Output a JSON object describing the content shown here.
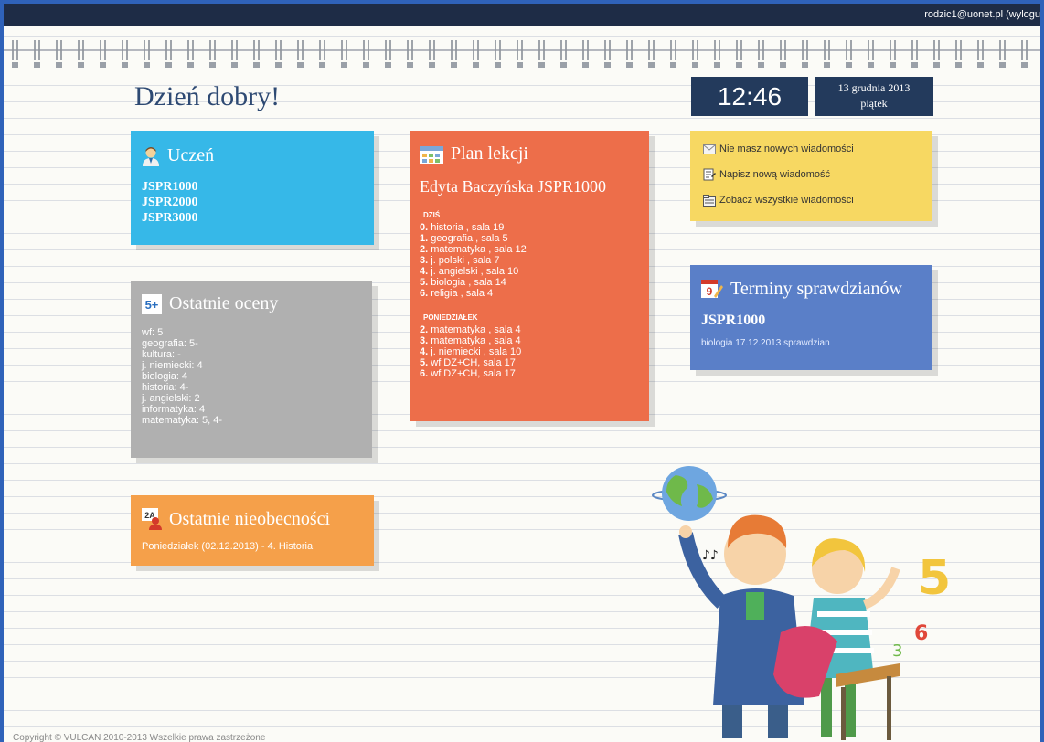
{
  "header": {
    "user_link": "rodzic1@uonet.pl (wylogu"
  },
  "greeting": "Dzień dobry!",
  "clock": {
    "time": "12:46",
    "date": "13 grudnia 2013",
    "weekday": "piątek"
  },
  "uczen": {
    "title": "Uczeń",
    "icon": "student-icon",
    "items": [
      "JSPR1000",
      "JSPR2000",
      "JSPR3000"
    ]
  },
  "oceny": {
    "title": "Ostatnie oceny",
    "icon": "grade-5plus-icon",
    "icon_text": "5+",
    "items": [
      "wf: 5",
      "geografia: 5-",
      "kultura: -",
      "j. niemiecki: 4",
      "biologia: 4",
      "historia: 4-",
      "j. angielski: 2",
      "informatyka: 4",
      "matematyka: 5, 4-"
    ]
  },
  "nieobecnosci": {
    "title": "Ostatnie nieobecności",
    "icon": "absence-icon",
    "icon_text": "2A",
    "items": [
      "Poniedziałek (02.12.2013) - 4. Historia"
    ]
  },
  "plan": {
    "title": "Plan lekcji",
    "icon": "schedule-icon",
    "teacher": "Edyta Baczyńska JSPR1000",
    "today_label": "DZIŚ",
    "today": [
      {
        "num": "0.",
        "text": " historia , sala 19"
      },
      {
        "num": "1.",
        "text": " geografia , sala 5"
      },
      {
        "num": "2.",
        "text": " matematyka , sala 12"
      },
      {
        "num": "3.",
        "text": " j. polski , sala 7"
      },
      {
        "num": "4.",
        "text": " j. angielski , sala 10"
      },
      {
        "num": "5.",
        "text": " biologia , sala 14"
      },
      {
        "num": "6.",
        "text": " religia , sala 4"
      }
    ],
    "next_label": "PONIEDZIAŁEK",
    "next": [
      {
        "num": "2.",
        "text": " matematyka , sala 4"
      },
      {
        "num": "3.",
        "text": " matematyka , sala 4"
      },
      {
        "num": "4.",
        "text": " j. niemiecki , sala 10"
      },
      {
        "num": "5.",
        "text": " wf DZ+CH, sala 17"
      },
      {
        "num": "6.",
        "text": " wf DZ+CH, sala 17"
      }
    ]
  },
  "messages": {
    "no_new": "Nie masz nowych wiadomości",
    "write": "Napisz nową wiadomość",
    "view_all": "Zobacz wszystkie wiadomości"
  },
  "sprawdziany": {
    "title": "Terminy sprawdzianów",
    "icon": "calendar-icon",
    "icon_text": "9",
    "klasa": "JSPR1000",
    "items": [
      "biologia 17.12.2013 sprawdzian"
    ]
  },
  "illustration": {
    "numbers": [
      "5",
      "6",
      "3"
    ]
  },
  "footer": {
    "copyright": "Copyright © VULCAN 2010-2013 Wszelkie prawa zastrzeżone"
  },
  "colors": {
    "uczen": "#36b8e8",
    "oceny": "#b0b0b0",
    "nieobecnosci": "#f5a04a",
    "plan": "#ed6e4a",
    "messages": "#f7d862",
    "sprawdziany": "#5a7fc8",
    "clock": "#233a5c"
  }
}
